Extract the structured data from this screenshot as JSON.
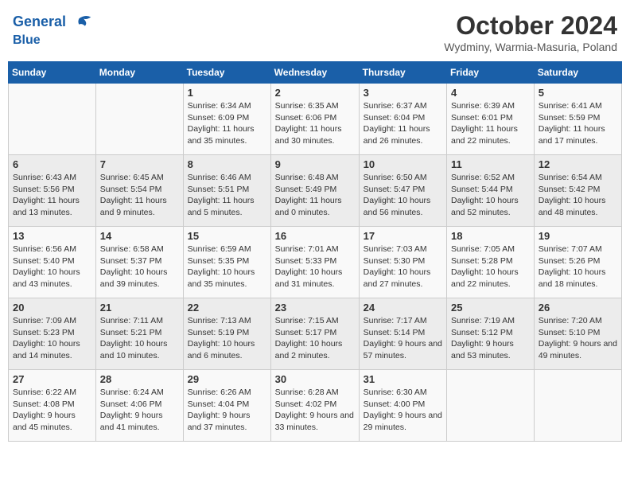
{
  "header": {
    "logo_line1": "General",
    "logo_line2": "Blue",
    "month": "October 2024",
    "location": "Wydminy, Warmia-Masuria, Poland"
  },
  "days_of_week": [
    "Sunday",
    "Monday",
    "Tuesday",
    "Wednesday",
    "Thursday",
    "Friday",
    "Saturday"
  ],
  "weeks": [
    [
      {
        "day": "",
        "info": ""
      },
      {
        "day": "",
        "info": ""
      },
      {
        "day": "1",
        "info": "Sunrise: 6:34 AM\nSunset: 6:09 PM\nDaylight: 11 hours and 35 minutes."
      },
      {
        "day": "2",
        "info": "Sunrise: 6:35 AM\nSunset: 6:06 PM\nDaylight: 11 hours and 30 minutes."
      },
      {
        "day": "3",
        "info": "Sunrise: 6:37 AM\nSunset: 6:04 PM\nDaylight: 11 hours and 26 minutes."
      },
      {
        "day": "4",
        "info": "Sunrise: 6:39 AM\nSunset: 6:01 PM\nDaylight: 11 hours and 22 minutes."
      },
      {
        "day": "5",
        "info": "Sunrise: 6:41 AM\nSunset: 5:59 PM\nDaylight: 11 hours and 17 minutes."
      }
    ],
    [
      {
        "day": "6",
        "info": "Sunrise: 6:43 AM\nSunset: 5:56 PM\nDaylight: 11 hours and 13 minutes."
      },
      {
        "day": "7",
        "info": "Sunrise: 6:45 AM\nSunset: 5:54 PM\nDaylight: 11 hours and 9 minutes."
      },
      {
        "day": "8",
        "info": "Sunrise: 6:46 AM\nSunset: 5:51 PM\nDaylight: 11 hours and 5 minutes."
      },
      {
        "day": "9",
        "info": "Sunrise: 6:48 AM\nSunset: 5:49 PM\nDaylight: 11 hours and 0 minutes."
      },
      {
        "day": "10",
        "info": "Sunrise: 6:50 AM\nSunset: 5:47 PM\nDaylight: 10 hours and 56 minutes."
      },
      {
        "day": "11",
        "info": "Sunrise: 6:52 AM\nSunset: 5:44 PM\nDaylight: 10 hours and 52 minutes."
      },
      {
        "day": "12",
        "info": "Sunrise: 6:54 AM\nSunset: 5:42 PM\nDaylight: 10 hours and 48 minutes."
      }
    ],
    [
      {
        "day": "13",
        "info": "Sunrise: 6:56 AM\nSunset: 5:40 PM\nDaylight: 10 hours and 43 minutes."
      },
      {
        "day": "14",
        "info": "Sunrise: 6:58 AM\nSunset: 5:37 PM\nDaylight: 10 hours and 39 minutes."
      },
      {
        "day": "15",
        "info": "Sunrise: 6:59 AM\nSunset: 5:35 PM\nDaylight: 10 hours and 35 minutes."
      },
      {
        "day": "16",
        "info": "Sunrise: 7:01 AM\nSunset: 5:33 PM\nDaylight: 10 hours and 31 minutes."
      },
      {
        "day": "17",
        "info": "Sunrise: 7:03 AM\nSunset: 5:30 PM\nDaylight: 10 hours and 27 minutes."
      },
      {
        "day": "18",
        "info": "Sunrise: 7:05 AM\nSunset: 5:28 PM\nDaylight: 10 hours and 22 minutes."
      },
      {
        "day": "19",
        "info": "Sunrise: 7:07 AM\nSunset: 5:26 PM\nDaylight: 10 hours and 18 minutes."
      }
    ],
    [
      {
        "day": "20",
        "info": "Sunrise: 7:09 AM\nSunset: 5:23 PM\nDaylight: 10 hours and 14 minutes."
      },
      {
        "day": "21",
        "info": "Sunrise: 7:11 AM\nSunset: 5:21 PM\nDaylight: 10 hours and 10 minutes."
      },
      {
        "day": "22",
        "info": "Sunrise: 7:13 AM\nSunset: 5:19 PM\nDaylight: 10 hours and 6 minutes."
      },
      {
        "day": "23",
        "info": "Sunrise: 7:15 AM\nSunset: 5:17 PM\nDaylight: 10 hours and 2 minutes."
      },
      {
        "day": "24",
        "info": "Sunrise: 7:17 AM\nSunset: 5:14 PM\nDaylight: 9 hours and 57 minutes."
      },
      {
        "day": "25",
        "info": "Sunrise: 7:19 AM\nSunset: 5:12 PM\nDaylight: 9 hours and 53 minutes."
      },
      {
        "day": "26",
        "info": "Sunrise: 7:20 AM\nSunset: 5:10 PM\nDaylight: 9 hours and 49 minutes."
      }
    ],
    [
      {
        "day": "27",
        "info": "Sunrise: 6:22 AM\nSunset: 4:08 PM\nDaylight: 9 hours and 45 minutes."
      },
      {
        "day": "28",
        "info": "Sunrise: 6:24 AM\nSunset: 4:06 PM\nDaylight: 9 hours and 41 minutes."
      },
      {
        "day": "29",
        "info": "Sunrise: 6:26 AM\nSunset: 4:04 PM\nDaylight: 9 hours and 37 minutes."
      },
      {
        "day": "30",
        "info": "Sunrise: 6:28 AM\nSunset: 4:02 PM\nDaylight: 9 hours and 33 minutes."
      },
      {
        "day": "31",
        "info": "Sunrise: 6:30 AM\nSunset: 4:00 PM\nDaylight: 9 hours and 29 minutes."
      },
      {
        "day": "",
        "info": ""
      },
      {
        "day": "",
        "info": ""
      }
    ]
  ]
}
